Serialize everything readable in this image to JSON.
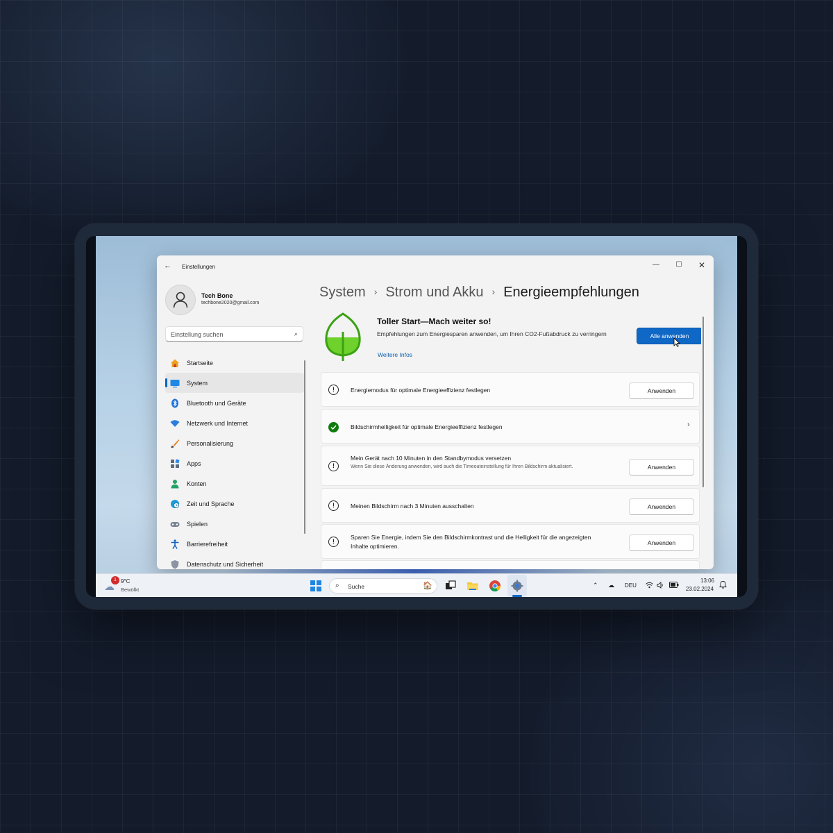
{
  "window": {
    "app_title": "Einstellungen",
    "controls": {
      "minimize": "—",
      "maximize": "☐",
      "close": "✕"
    }
  },
  "user": {
    "name": "Tech Bone",
    "email": "techbone2020@gmail.com"
  },
  "search": {
    "placeholder": "Einstellung suchen"
  },
  "sidebar": {
    "items": [
      {
        "label": "Startseite",
        "icon": "home-icon"
      },
      {
        "label": "System",
        "icon": "system-display-icon",
        "active": true
      },
      {
        "label": "Bluetooth und Geräte",
        "icon": "bluetooth-icon"
      },
      {
        "label": "Netzwerk und Internet",
        "icon": "wifi-icon"
      },
      {
        "label": "Personalisierung",
        "icon": "brush-icon"
      },
      {
        "label": "Apps",
        "icon": "apps-icon"
      },
      {
        "label": "Konten",
        "icon": "account-icon"
      },
      {
        "label": "Zeit und Sprache",
        "icon": "globe-clock-icon"
      },
      {
        "label": "Spielen",
        "icon": "gamepad-icon"
      },
      {
        "label": "Barrierefreiheit",
        "icon": "accessibility-icon"
      },
      {
        "label": "Datenschutz und Sicherheit",
        "icon": "shield-icon"
      }
    ]
  },
  "breadcrumb": {
    "part1": "System",
    "part2": "Strom und Akku",
    "part3": "Energieempfehlungen"
  },
  "hero": {
    "title": "Toller Start—Mach weiter so!",
    "description": "Empfehlungen zum Energiesparen anwenden, um Ihren CO2-Fußabdruck zu verringern",
    "link": "Weitere Infos",
    "apply_all": "Alle anwenden",
    "leaf_color": "#3aa212"
  },
  "recommendations": [
    {
      "title": "Energiemodus für optimale Energieeffizienz festlegen",
      "status": "pending",
      "action": "Anwenden"
    },
    {
      "title": "Bildschirmhelligkeit für optimale Energieeffizienz festlegen",
      "status": "done"
    },
    {
      "title": "Mein Gerät nach 10 Minuten in den Standbymodus versetzen",
      "subtitle": "Wenn Sie diese Änderung anwenden, wird auch die Timeouteinstellung für Ihren Bildschirm aktualisiert.",
      "status": "pending",
      "action": "Anwenden"
    },
    {
      "title": "Meinen Bildschirm nach 3 Minuten ausschalten",
      "status": "pending",
      "action": "Anwenden"
    },
    {
      "title": "Sparen Sie Energie, indem Sie den Bildschirmkontrast und die Helligkeit für die angezeigten Inhalte optimieren.",
      "status": "pending",
      "action": "Anwenden"
    }
  ],
  "taskbar": {
    "weather": {
      "badge": "1",
      "temp": "9°C",
      "condition": "Bewölkt"
    },
    "search_label": "Suche",
    "language": "DEU",
    "time": "13:06",
    "date": "23.02.2024"
  },
  "colors": {
    "accent": "#0f67c6",
    "success": "#0f7b0f"
  }
}
